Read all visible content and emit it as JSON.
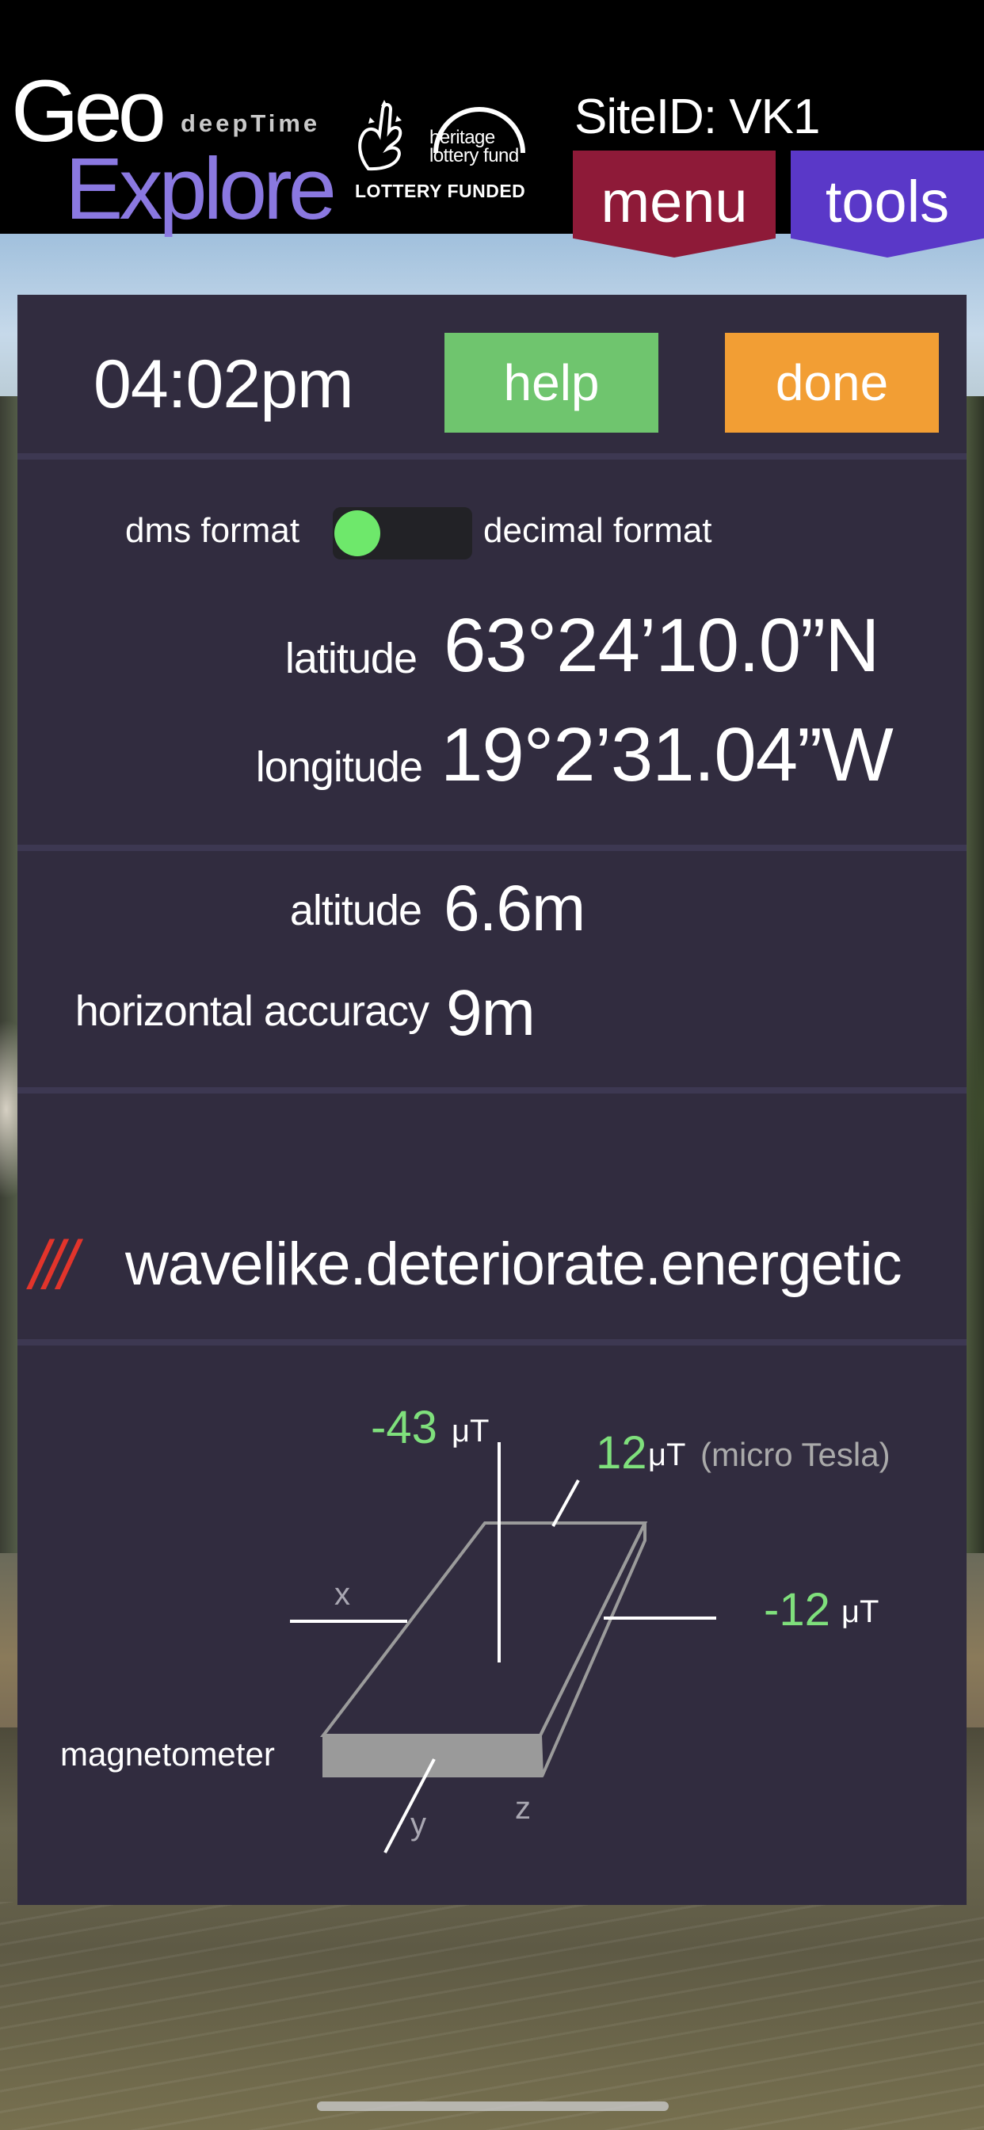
{
  "header": {
    "logo": {
      "geo": "Geo",
      "deeptime": "deepTime",
      "explore": "Explore"
    },
    "heritage_fund": "heritage lottery fund",
    "lottery_funded": "LOTTERY FUNDED",
    "site_id": "SiteID: VK1",
    "menu_label": "menu",
    "tools_label": "tools",
    "colors": {
      "menu": "#8e1a38",
      "tools": "#5a38c8"
    }
  },
  "panel": {
    "time": "04:02pm",
    "help_label": "help",
    "done_label": "done",
    "format_toggle": {
      "left_label": "dms format",
      "right_label": "decimal format",
      "state": "dms"
    },
    "latitude": {
      "label": "latitude",
      "value": "63°24’10.0”N"
    },
    "longitude": {
      "label": "longitude",
      "value": "19°2’31.04”W"
    },
    "altitude": {
      "label": "altitude",
      "value": "6.6m"
    },
    "horizontal_accuracy": {
      "label": "horizontal accuracy",
      "value": "9m"
    },
    "what3words": {
      "prefix": "///",
      "address": "wavelike.deteriorate.energetic"
    },
    "magnetometer": {
      "title": "magnetometer",
      "unit": "μT",
      "note": "(micro Tesla)",
      "vertical_value": "-43",
      "top_value": "12",
      "side_value": "-12",
      "axis_x": "x",
      "axis_y": "y",
      "axis_z": "z",
      "value_color": "#7fe07c"
    }
  }
}
